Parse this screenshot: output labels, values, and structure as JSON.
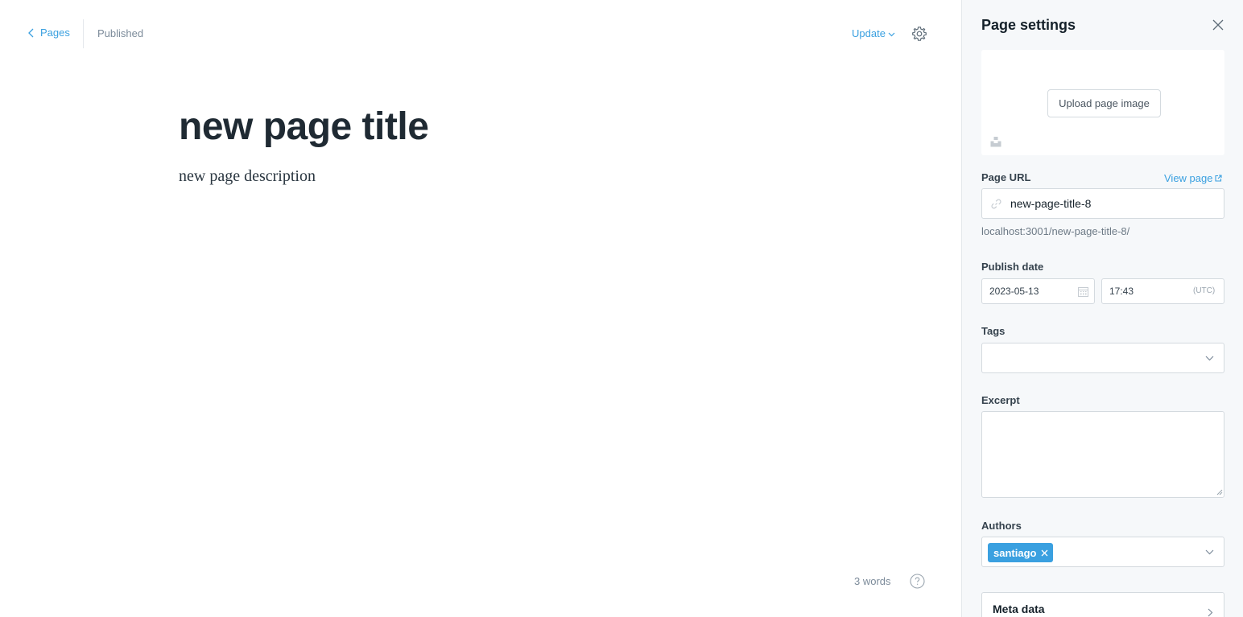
{
  "editor": {
    "back_label": "Pages",
    "status": "Published",
    "update_label": "Update",
    "title": "new page title",
    "description": "new page description",
    "word_count": "3 words"
  },
  "panel": {
    "title": "Page settings",
    "upload_label": "Upload page image",
    "url_label": "Page URL",
    "view_page_label": "View page",
    "url_value": "new-page-title-8",
    "url_hint": "localhost:3001/new-page-title-8/",
    "publish_label": "Publish date",
    "publish_date": "2023-05-13",
    "publish_time": "17:43",
    "timezone": "(UTC)",
    "tags_label": "Tags",
    "excerpt_label": "Excerpt",
    "authors_label": "Authors",
    "authors": [
      "santiago"
    ],
    "meta_label": "Meta data"
  },
  "colors": {
    "accent": "#3aa0e0",
    "panel_bg": "#f6f8fa",
    "border": "#d4dadf",
    "muted_text": "#7c8b9a"
  },
  "icons": [
    "chevron-left-icon",
    "chevron-down-icon",
    "gear-icon",
    "close-icon",
    "unsplash-icon",
    "external-link-icon",
    "link-icon",
    "calendar-icon",
    "help-icon",
    "chevron-right-icon"
  ]
}
